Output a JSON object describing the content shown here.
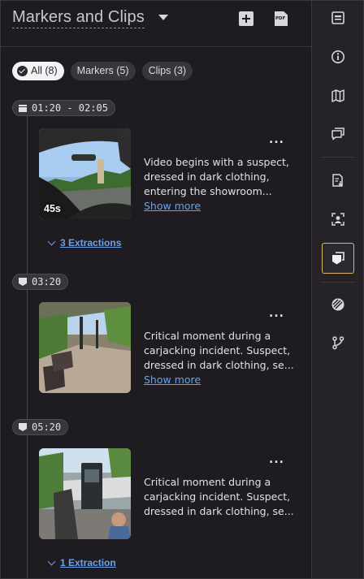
{
  "header": {
    "title": "Markers and Clips",
    "add_icon": "add-square-icon",
    "pdf_icon": "pdf-file-icon",
    "pdf_label": "PDF"
  },
  "filters": [
    {
      "label": "All (8)",
      "active": true
    },
    {
      "label": "Markers (5)",
      "active": false
    },
    {
      "label": "Clips (3)",
      "active": false
    }
  ],
  "items": [
    {
      "kind": "clip",
      "time": "01:20 - 02:05",
      "duration": "45s",
      "text_lines": [
        "Video begins with a suspect,",
        "dressed in dark clothing,",
        "entering the showroom..."
      ],
      "show_more": "Show more",
      "extractions": "3 Extractions"
    },
    {
      "kind": "marker",
      "time": "03:20",
      "text_lines": [
        "Critical moment during a",
        "carjacking incident. Suspect,",
        "dressed in dark clothing, se..."
      ],
      "show_more": "Show more"
    },
    {
      "kind": "marker",
      "time": "05:20",
      "text_lines": [
        "Critical moment during a",
        "carjacking incident. Suspect,",
        "dressed in dark clothing, se..."
      ],
      "extractions": "1 Extraction"
    }
  ],
  "more_label": "...",
  "sidebar": {
    "items": [
      "overview-icon",
      "info-icon",
      "map-icon",
      "comments-icon",
      "report-download-icon",
      "face-detect-icon",
      "markers-icon",
      "redact-icon",
      "branch-icon"
    ],
    "active": "markers-icon"
  },
  "colors": {
    "accent": "#d9b969",
    "link": "#6aa2e8",
    "background": "#1e1c21"
  }
}
